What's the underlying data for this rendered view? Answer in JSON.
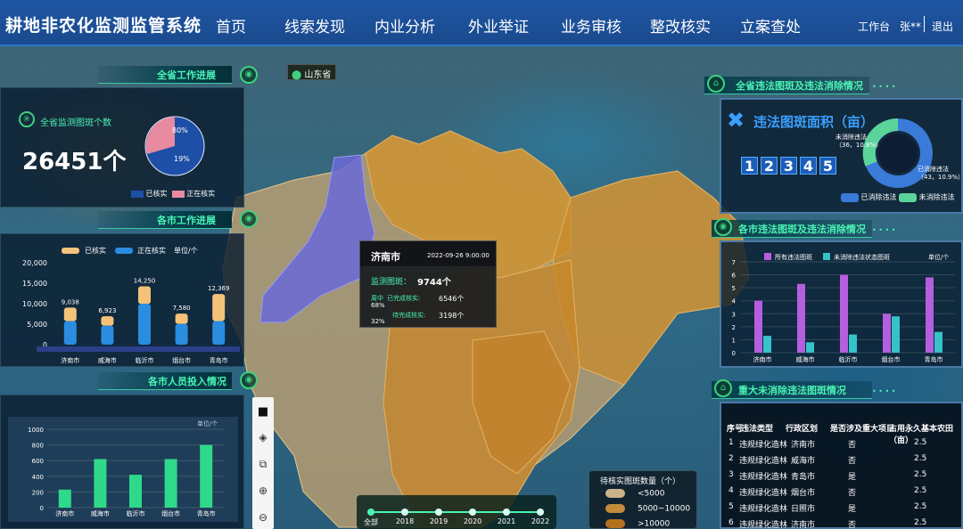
{
  "header": {
    "title": "耕地非农化监测监管系统",
    "nav": [
      "首页",
      "线索发现",
      "内业分析",
      "外业举证",
      "业务审核",
      "整改核实",
      "立案查处"
    ],
    "workbench": "工作台",
    "user": "张**",
    "logout": "退出"
  },
  "map": {
    "location_tag": "山东省",
    "tooltip": {
      "city": "济南市",
      "time": "2022-09-26  9:00:00",
      "monitor_label": "监测图斑：",
      "monitor_value": "9744个",
      "done_label": "已完成核实:",
      "done_value": "6546个",
      "done_pct": "68%",
      "pending_label": "待完成核实:",
      "pending_value": "3198个",
      "pending_pct": "32%",
      "week_label": "周中"
    },
    "timeline": [
      "全部",
      "2018",
      "2019",
      "2020",
      "2021",
      "2022"
    ],
    "legend": {
      "title": "待核实图斑数量（个）",
      "items": [
        {
          "label": "<5000",
          "color": "#cbb38a"
        },
        {
          "label": "5000~10000",
          "color": "#c58a3a"
        },
        {
          "label": ">10000",
          "color": "#b3701e"
        }
      ]
    }
  },
  "left": {
    "progress": {
      "title": "全省工作进展",
      "subtitle": "全省监测图斑个数",
      "total": "26451个",
      "pie": {
        "done_pct": "80%",
        "doing_pct": "19%"
      },
      "legend": [
        "已核实",
        "正在核实"
      ]
    },
    "city_progress": {
      "title": "各市工作进展",
      "legend": [
        "已核实",
        "正在核实",
        "单位/个"
      ]
    },
    "staff": {
      "title": "各市人员投入情况",
      "unit": "单位/个"
    }
  },
  "chart_data": [
    {
      "type": "bar",
      "title": "各市工作进展",
      "categories": [
        "济南市",
        "威海市",
        "临沂市",
        "烟台市",
        "青岛市"
      ],
      "series": [
        {
          "name": "已核实",
          "values": [
            3300,
            2300,
            4300,
            2500,
            6600
          ]
        },
        {
          "name": "正在核实",
          "values": [
            5738,
            4623,
            9950,
            5080,
            5769
          ]
        }
      ],
      "totals": [
        9038,
        6923,
        14250,
        7580,
        12369
      ],
      "ylim": [
        0,
        20000
      ],
      "yticks": [
        "0",
        "5,000",
        "10,000",
        "15,000",
        "20,000"
      ]
    },
    {
      "type": "bar",
      "title": "各市人员投入情况",
      "categories": [
        "济南市",
        "威海市",
        "临沂市",
        "烟台市",
        "青岛市"
      ],
      "values": [
        230,
        620,
        420,
        620,
        800
      ],
      "ylim": [
        0,
        1000
      ],
      "yticks": [
        "0",
        "200",
        "400",
        "600",
        "800",
        "1000"
      ]
    },
    {
      "type": "bar",
      "title": "各市违法图斑及违法消除情况",
      "categories": [
        "济南市",
        "威海市",
        "临沂市",
        "烟台市",
        "青岛市"
      ],
      "series": [
        {
          "name": "所有违法图斑",
          "values": [
            4,
            5.3,
            6,
            3,
            5.8
          ]
        },
        {
          "name": "未消除违法状态图斑",
          "values": [
            1.3,
            0.8,
            1.4,
            2.8,
            1.6
          ]
        }
      ],
      "ylim": [
        0,
        7
      ],
      "yticks": [
        "0",
        "1",
        "2",
        "3",
        "4",
        "5",
        "6",
        "7"
      ]
    },
    {
      "type": "pie",
      "title": "违法图斑面积（亩）",
      "slices": [
        {
          "name": "未消除违法",
          "value": 36,
          "pct": "10.8%"
        },
        {
          "name": "已消除违法",
          "value": 43,
          "pct": "10.9%"
        }
      ]
    }
  ],
  "right": {
    "area": {
      "section_title": "全省违法图斑及违法消除情况",
      "title": "违法图斑面积（亩）",
      "digits": [
        "1",
        "2",
        "3",
        "4",
        "5"
      ],
      "pie_top_label": "未消除违法",
      "pie_top_value": "（36，10.8%）",
      "pie_bottom_label": "已消除违法",
      "pie_bottom_value": "（43，10.9%）",
      "legend": [
        "已消除违法",
        "未消除违法"
      ]
    },
    "city_illegal": {
      "title": "各市违法图斑及违法消除情况",
      "legend": [
        "所有违法图斑",
        "未消除违法状态图斑"
      ],
      "unit": "单位/个"
    },
    "major": {
      "title": "重大未消除违法图斑情况",
      "columns": [
        "序号",
        "违法类型",
        "行政区划",
        "是否涉及重大项目",
        "占用永久基本农田（亩）"
      ],
      "rows": [
        [
          "1",
          "违规绿化造林",
          "济南市",
          "否",
          "2.5"
        ],
        [
          "2",
          "违规绿化造林",
          "威海市",
          "否",
          "2.5"
        ],
        [
          "3",
          "违规绿化造林",
          "青岛市",
          "是",
          "2.5"
        ],
        [
          "4",
          "违规绿化造林",
          "烟台市",
          "否",
          "2.5"
        ],
        [
          "5",
          "违规绿化造林",
          "日照市",
          "是",
          "2.5"
        ],
        [
          "6",
          "违规绿化造林",
          "济南市",
          "否",
          "2.5"
        ]
      ]
    }
  },
  "colors": {
    "accent": "#49f3b4",
    "header": "#1f56a3",
    "jinan": "#6a6ad8",
    "yellow": "#c58a3a"
  }
}
